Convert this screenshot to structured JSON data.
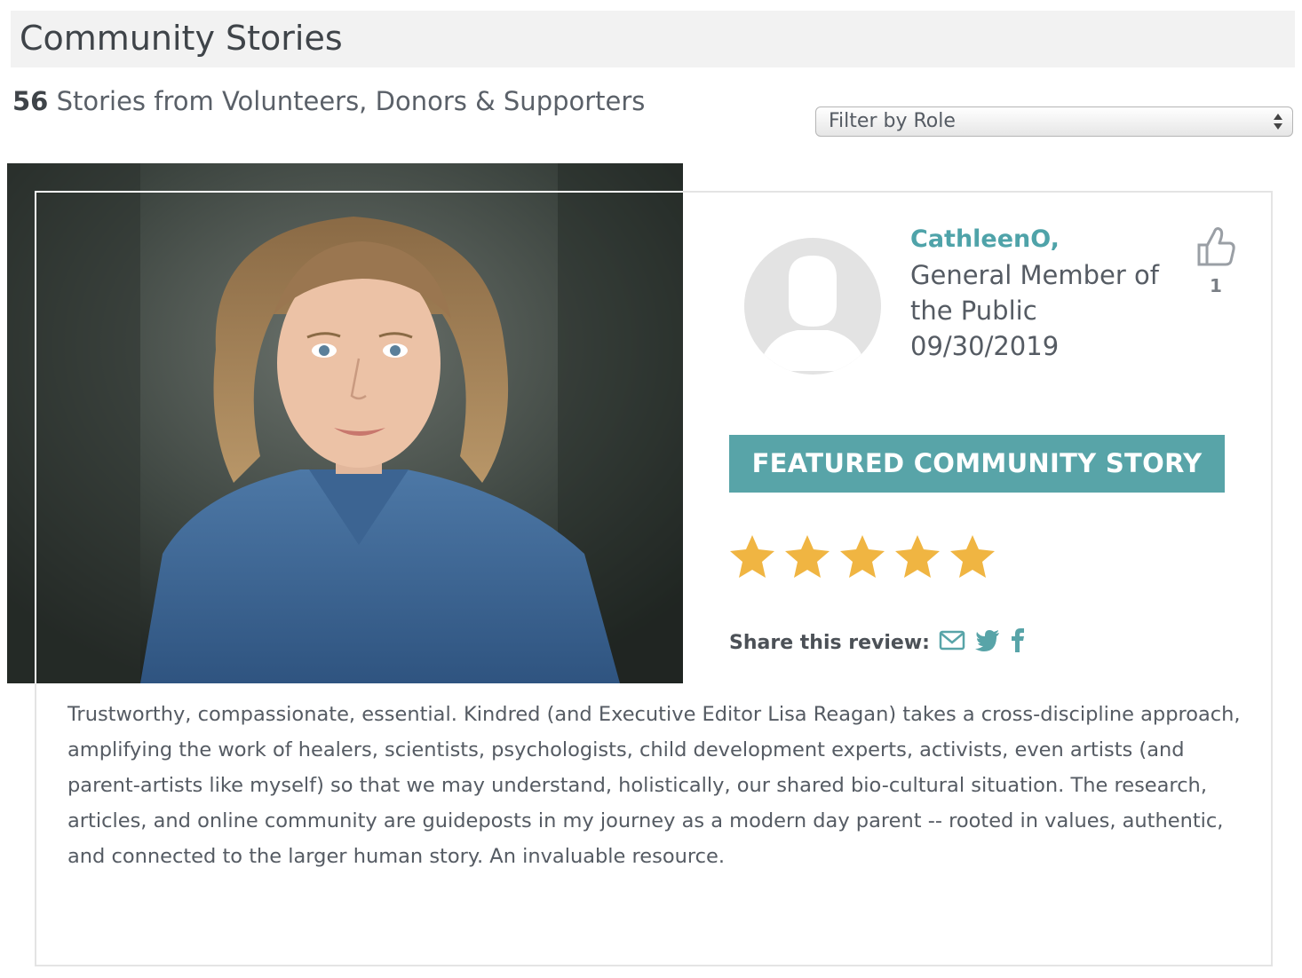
{
  "page": {
    "title": "Community Stories",
    "count": "56",
    "count_suffix": "Stories from Volunteers, Donors & Supporters"
  },
  "filter": {
    "selected": "Filter by Role"
  },
  "review": {
    "author_name": "CathleenO,",
    "author_role": "General Member of the Public",
    "date": "09/30/2019",
    "likes": "1",
    "badge": "FEATURED COMMUNITY STORY",
    "rating": 5,
    "rating_max": 5,
    "share_label": "Share this review:",
    "text": "Trustworthy, compassionate, essential. Kindred (and Executive Editor Lisa Reagan) takes a cross-discipline approach, amplifying the work of healers, scientists, psychologists, child development experts, activists, even artists (and parent-artists like myself) so that we may understand, holistically, our shared bio-cultural situation. The research, articles, and online community are guideposts in my journey as a modern day parent -- rooted in values, authentic, and connected to the larger human story. An invaluable resource."
  },
  "colors": {
    "accent": "#58a4a8",
    "star": "#f0b542",
    "header_bg": "#f2f2f2"
  },
  "icons": {
    "like": "thumbs-up-icon",
    "email": "envelope-icon",
    "twitter": "twitter-icon",
    "facebook": "facebook-icon",
    "select": "up-down-arrows-icon"
  }
}
